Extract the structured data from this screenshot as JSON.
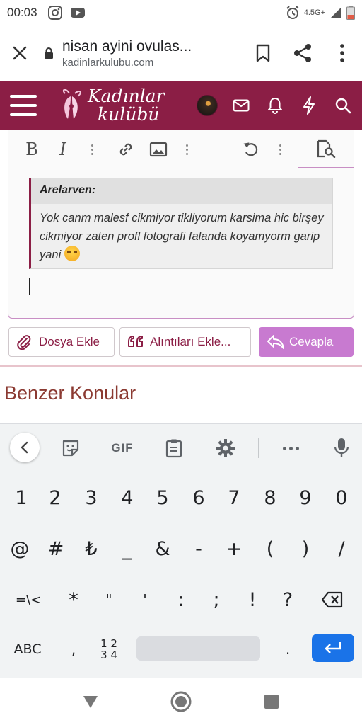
{
  "status_bar": {
    "time": "00:03",
    "network": "4.5G+",
    "icons": [
      "instagram-icon",
      "youtube-icon",
      "alarm-icon",
      "signal-icon",
      "battery-icon"
    ]
  },
  "browser": {
    "tab_title": "nisan ayini ovulas...",
    "domain": "kadinlarkulubu.com",
    "icons": [
      "close-icon",
      "lock-icon",
      "bookmark-icon",
      "share-icon",
      "menu-icon"
    ]
  },
  "site_header": {
    "brand_line1": "Kadınlar",
    "brand_line2": "kulübü",
    "background": "#8b1e45",
    "icons": [
      "hamburger-icon",
      "avatar",
      "mail-icon",
      "bell-icon",
      "lightning-icon",
      "search-icon"
    ]
  },
  "editor": {
    "toolbar": {
      "bold": "B",
      "italic": "I",
      "icons": [
        "link-icon",
        "image-icon",
        "undo-icon",
        "preview-icon"
      ]
    },
    "quote": {
      "author": "Arelarven:",
      "text": "Yok canm malesf cikmiyor tikliyorum karsima hic birşey cikmiyor zaten profl fotografi falanda koyamyorm garip yani"
    }
  },
  "actions": {
    "attach_label": "Dosya Ekle",
    "quotes_label": "Alıntıları Ekle...",
    "reply_label": "Cevapla",
    "reply_color": "#c87ad0"
  },
  "similar_heading": "Benzer Konular",
  "keyboard": {
    "gif_label": "GIF",
    "row1": [
      "1",
      "2",
      "3",
      "4",
      "5",
      "6",
      "7",
      "8",
      "9",
      "0"
    ],
    "row2": [
      "@",
      "#",
      "₺",
      "_",
      "&",
      "-",
      "+",
      "(",
      ")",
      "/"
    ],
    "row3": [
      "=\\<",
      "*",
      "\"",
      "'",
      ":",
      ";",
      "!",
      "?"
    ],
    "abc_label": "ABC",
    "comma": ",",
    "num_top": "1 2",
    "num_bottom": "3 4",
    "period": ".",
    "enter_color": "#1a73e8"
  },
  "nav": {
    "icons": [
      "back-triangle-icon",
      "home-circle-icon",
      "recents-square-icon"
    ]
  }
}
